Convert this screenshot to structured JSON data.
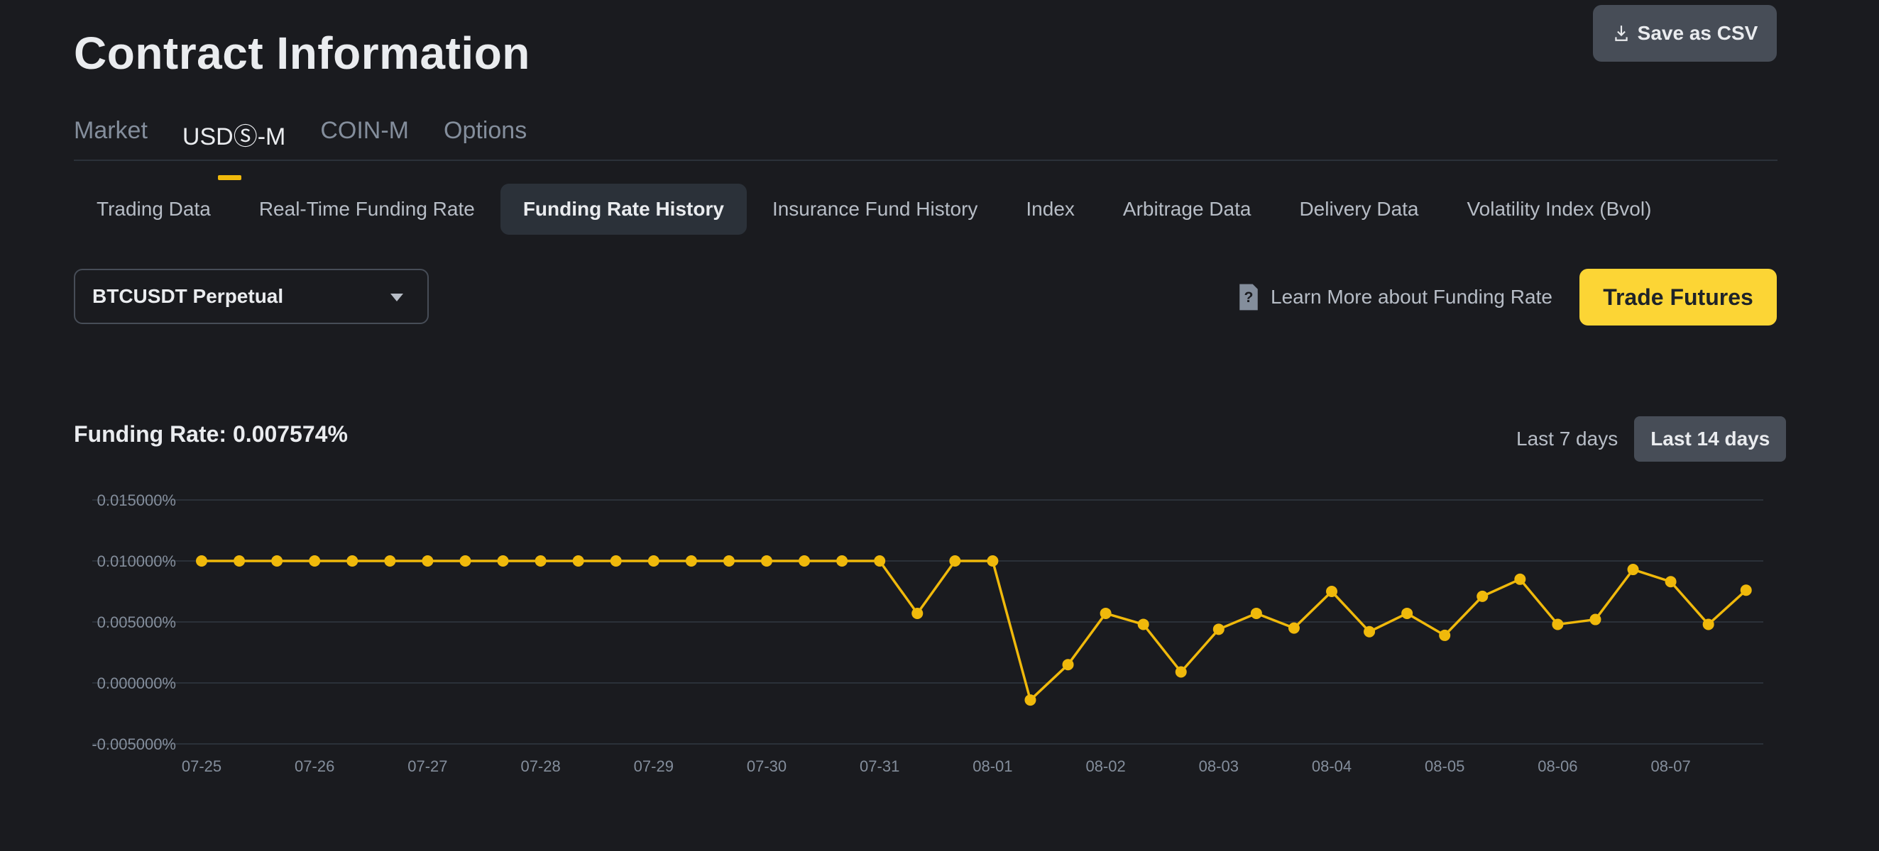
{
  "header": {
    "title": "Contract Information",
    "save_csv_label": "Save as CSV"
  },
  "top_tabs": [
    {
      "label": "Market",
      "active": false
    },
    {
      "label": "USDⓈ-M",
      "active": true
    },
    {
      "label": "COIN-M",
      "active": false
    },
    {
      "label": "Options",
      "active": false
    }
  ],
  "sub_tabs": [
    {
      "label": "Trading Data",
      "active": false
    },
    {
      "label": "Real-Time Funding Rate",
      "active": false
    },
    {
      "label": "Funding Rate History",
      "active": true
    },
    {
      "label": "Insurance Fund History",
      "active": false
    },
    {
      "label": "Index",
      "active": false
    },
    {
      "label": "Arbitrage Data",
      "active": false
    },
    {
      "label": "Delivery Data",
      "active": false
    },
    {
      "label": "Volatility Index (Bvol)",
      "active": false
    }
  ],
  "symbol_select": {
    "value": "BTCUSDT Perpetual"
  },
  "learn_more_label": "Learn More about Funding Rate",
  "trade_button_label": "Trade Futures",
  "funding_rate_label": "Funding Rate: 0.007574%",
  "range_buttons": [
    {
      "label": "Last 7 days",
      "active": false
    },
    {
      "label": "Last 14 days",
      "active": true
    }
  ],
  "colors": {
    "accent": "#f0b90b",
    "button_yellow": "#fcd535",
    "background": "#1a1b1f",
    "grid": "#2b3139"
  },
  "chart_data": {
    "type": "line",
    "title": "",
    "xlabel": "",
    "ylabel": "",
    "y_unit": "%",
    "ylim": [
      -0.005,
      0.015
    ],
    "y_ticks": [
      0.015,
      0.01,
      0.005,
      0.0,
      -0.005
    ],
    "y_tick_labels": [
      "0.015000%",
      "0.010000%",
      "0.005000%",
      "0.000000%",
      "-0.005000%"
    ],
    "x_tick_labels": [
      "07-25",
      "07-26",
      "07-27",
      "07-28",
      "07-29",
      "07-30",
      "07-31",
      "08-01",
      "08-02",
      "08-03",
      "08-04",
      "08-05",
      "08-06",
      "08-07"
    ],
    "points_per_day": 3,
    "grid": true,
    "series": [
      {
        "values": [
          0.01,
          0.01,
          0.01,
          0.01,
          0.01,
          0.01,
          0.01,
          0.01,
          0.01,
          0.01,
          0.01,
          0.01,
          0.01,
          0.01,
          0.01,
          0.01,
          0.01,
          0.01,
          0.01,
          0.0057,
          0.01,
          0.01,
          -0.0014,
          0.0015,
          0.0057,
          0.0048,
          0.0009,
          0.0044,
          0.0057,
          0.0045,
          0.0075,
          0.0042,
          0.0057,
          0.0039,
          0.0071,
          0.0085,
          0.0048,
          0.0052,
          0.0093,
          0.0083,
          0.0048,
          0.0076
        ]
      }
    ]
  }
}
